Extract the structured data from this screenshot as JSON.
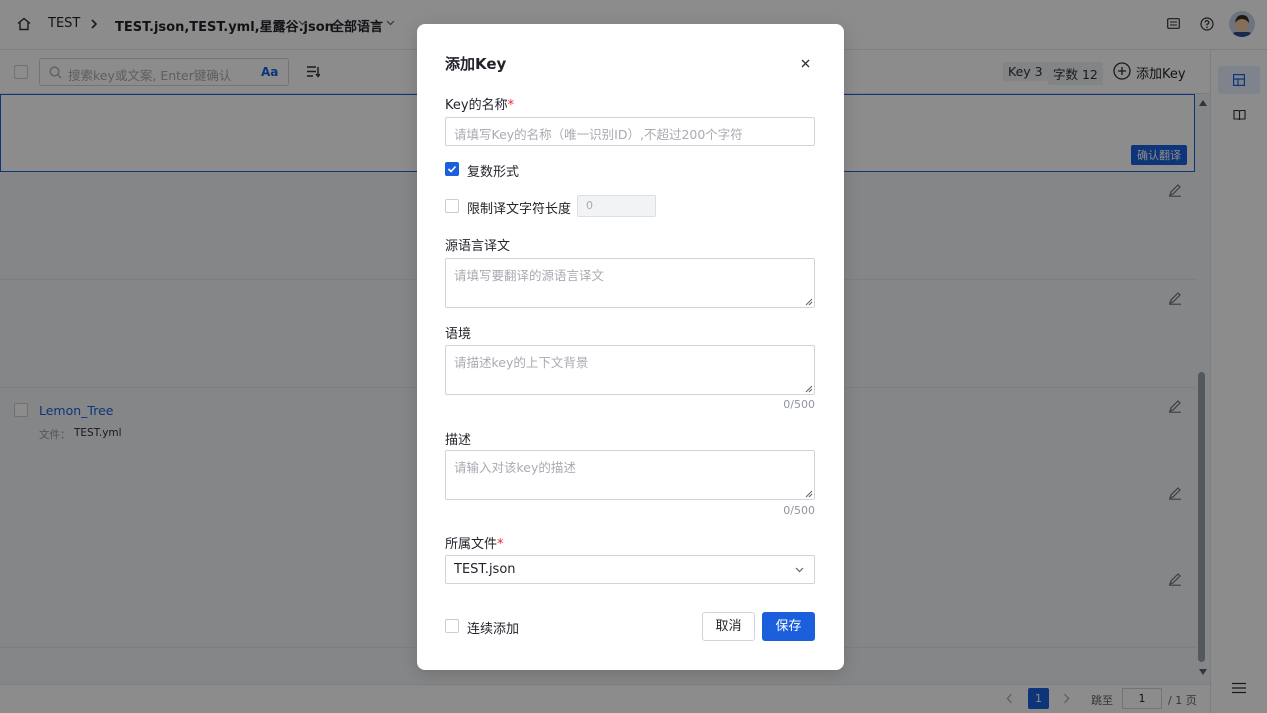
{
  "header": {
    "project": "TEST",
    "files": "TEST.json,TEST.yml,星露谷.json",
    "language": "全部语言"
  },
  "toolbar": {
    "search_placeholder": "搜索key或文案, Enter键确认",
    "match_case": "Aa",
    "key_count": "Key 3",
    "word_count": "字数 12",
    "add_key": "添加Key"
  },
  "rows": {
    "confirm_translation": "确认翻译",
    "item": {
      "name": "Lemon_Tree",
      "file_label": "文件：",
      "file_value": "TEST.yml"
    }
  },
  "pagination": {
    "current": "1",
    "jump_label": "跳至",
    "jump_value": "1",
    "total": "/ 1 页"
  },
  "modal": {
    "title": "添加Key",
    "key_name_label": "Key的名称",
    "key_name_placeholder": "请填写Key的名称（唯一识别ID）,不超过200个字符",
    "plural_label": "复数形式",
    "plural_checked": true,
    "limit_label": "限制译文字符长度",
    "limit_value": "0",
    "source_label": "源语言译文",
    "source_placeholder": "请填写要翻译的源语言译文",
    "context_label": "语境",
    "context_placeholder": "请描述key的上下文背景",
    "context_count": "0/500",
    "desc_label": "描述",
    "desc_placeholder": "请输入对该key的描述",
    "desc_count": "0/500",
    "file_label": "所属文件",
    "file_value": "TEST.json",
    "continuous_label": "连续添加",
    "cancel": "取消",
    "save": "保存"
  },
  "colors": {
    "primary": "#1b5fdc",
    "required": "#f5222d"
  }
}
